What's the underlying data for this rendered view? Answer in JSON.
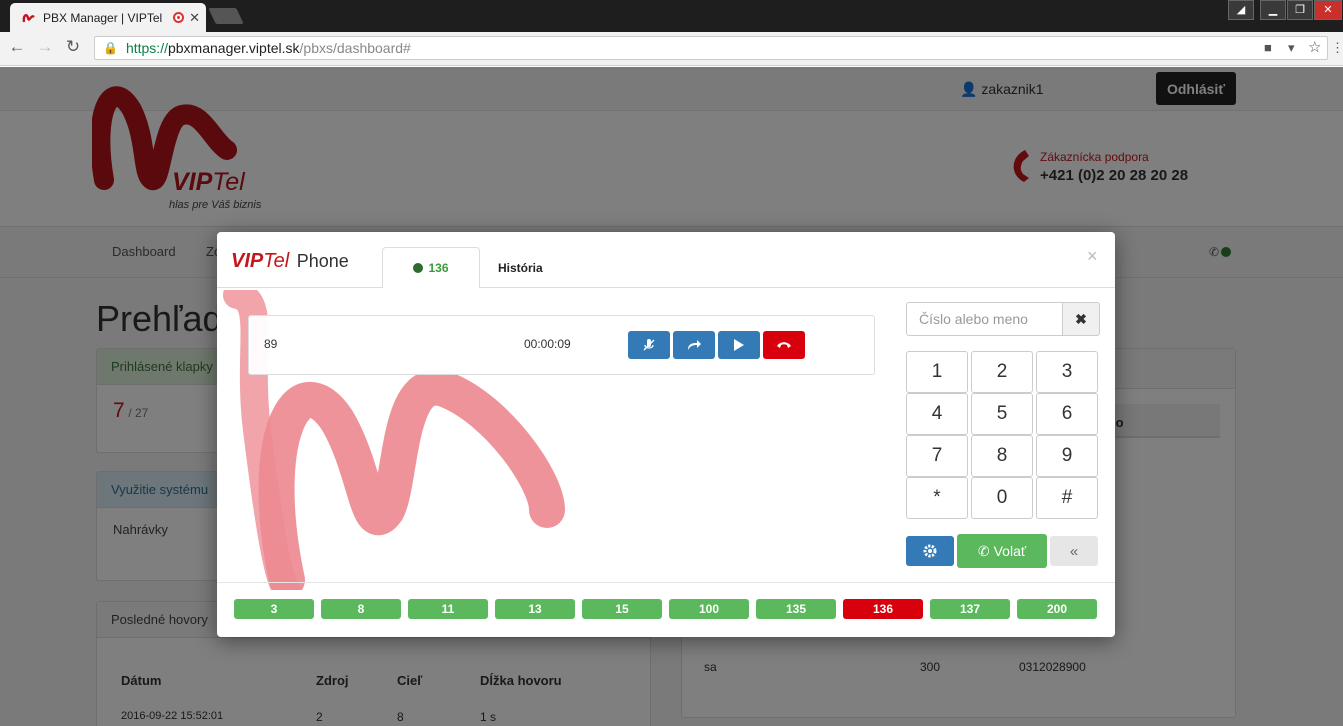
{
  "browser": {
    "tab_title": "PBX Manager | VIPTel",
    "url_scheme": "https://",
    "url_host": "pbxmanager.viptel.sk",
    "url_path": "/pbxs/dashboard#"
  },
  "user": {
    "username": "zakaznik1",
    "logout_label": "Odhlásiť"
  },
  "brand": {
    "name_vip": "VIP",
    "name_tel": "Tel",
    "slogan": "hlas pre Váš biznis",
    "accent": "#c4161c"
  },
  "support": {
    "label": "Zákaznícka podpora",
    "phone": "+421 (0)2 20 28 20 28"
  },
  "nav": {
    "items": [
      "Dashboard",
      "Zo"
    ]
  },
  "dashboard": {
    "title": "Prehľad",
    "logged_panel": {
      "header": "Prihlásené klapky",
      "value": "7",
      "total": "/ 27"
    },
    "usage_panel": {
      "header": "Využitie systému",
      "row_label": "Nahrávky"
    },
    "calls_panel": {
      "header": "Posledné hovory",
      "columns": [
        "Dátum",
        "Zdroj",
        "Cieľ",
        "Dĺžka hovoru"
      ],
      "rows": [
        [
          "2016-09-22 15:52:01",
          "2",
          "8",
          "1 s"
        ]
      ]
    },
    "right_panel": {
      "column_fragment": "lo",
      "row": [
        "sa",
        "300",
        "0312028900"
      ]
    }
  },
  "phone": {
    "title_vip": "VIP",
    "title_tel": "Tel",
    "title_phone": "Phone",
    "tabs": [
      {
        "label": "136",
        "status": "online"
      },
      {
        "label": "História"
      }
    ],
    "close_symbol": "×",
    "call": {
      "number": "89",
      "duration": "00:00:09"
    },
    "search_placeholder": "Číslo alebo meno",
    "keypad": [
      "1",
      "2",
      "3",
      "4",
      "5",
      "6",
      "7",
      "8",
      "9",
      "*",
      "0",
      "#"
    ],
    "call_button_label": "Volať",
    "back_symbol": "«",
    "extensions": [
      "3",
      "8",
      "11",
      "13",
      "15",
      "100",
      "135",
      "136",
      "137",
      "200"
    ],
    "active_extension": "136",
    "colors": {
      "primary": "#337ab7",
      "success": "#5cb85c",
      "danger": "#d9000d"
    }
  }
}
